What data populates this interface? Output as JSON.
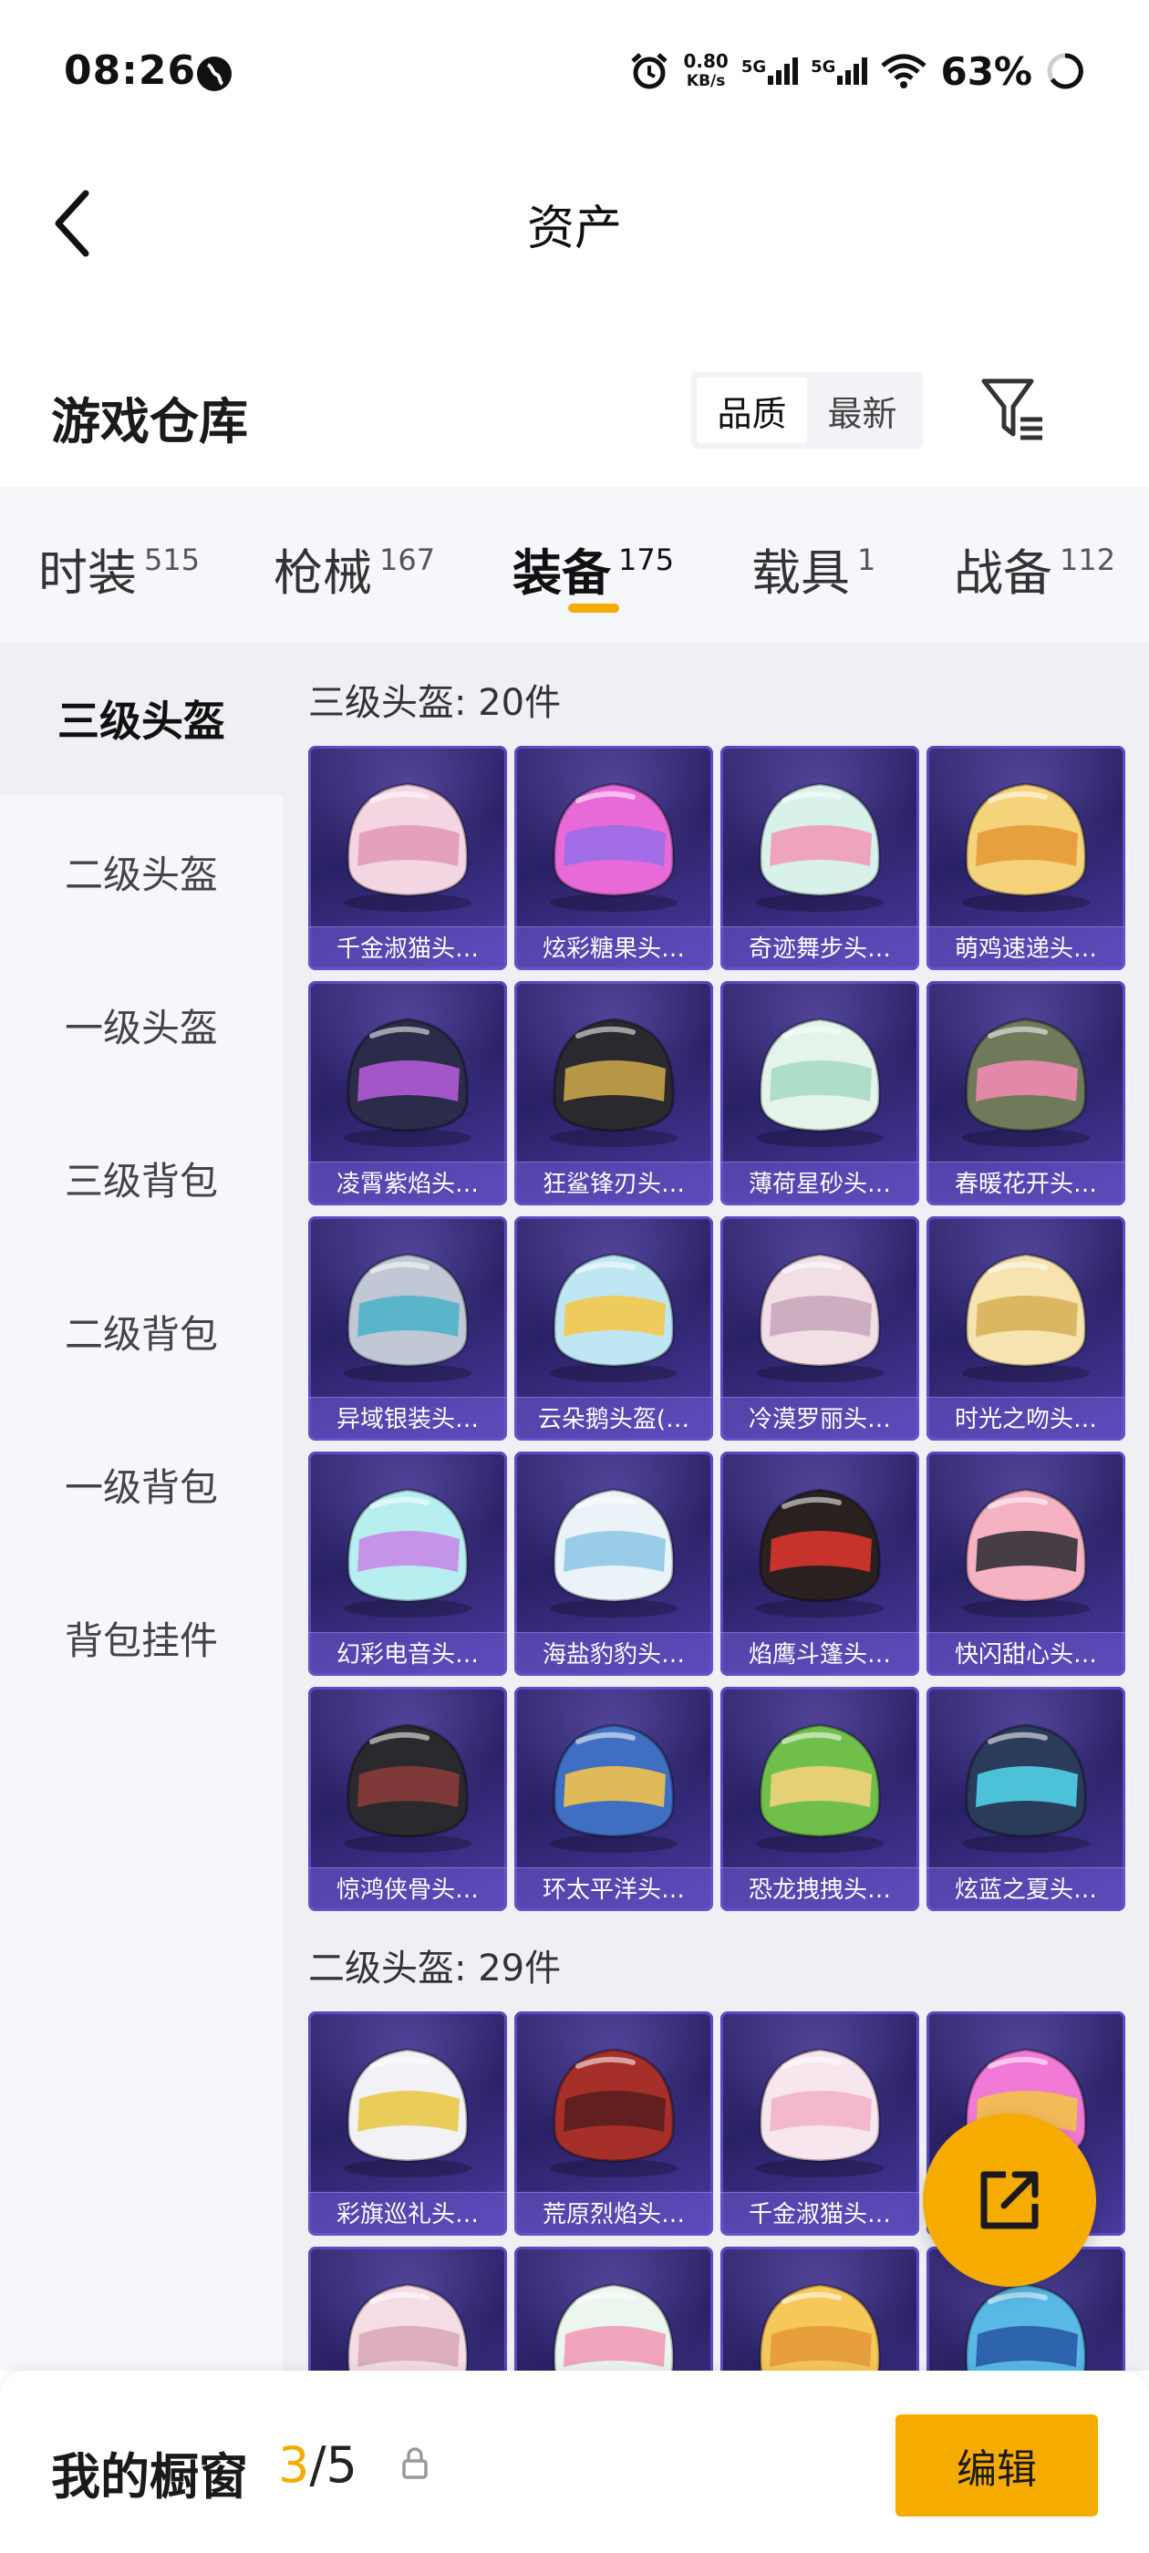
{
  "status_bar": {
    "time": "08:26",
    "net_speed_value": "0.80",
    "net_speed_unit": "KB/s",
    "sim1": "5G",
    "sim2": "5G",
    "battery": "63%"
  },
  "header": {
    "title": "资产"
  },
  "warehouse": {
    "title": "游戏仓库",
    "sort_options": [
      {
        "label": "品质",
        "active": true
      },
      {
        "label": "最新",
        "active": false
      }
    ]
  },
  "tabs": [
    {
      "label": "时装",
      "count": "515"
    },
    {
      "label": "枪械",
      "count": "167"
    },
    {
      "label": "装备",
      "count": "175",
      "active": true
    },
    {
      "label": "载具",
      "count": "1"
    },
    {
      "label": "战备",
      "count": "112"
    }
  ],
  "sidebar": {
    "items": [
      {
        "label": "三级头盔",
        "active": true
      },
      {
        "label": "二级头盔"
      },
      {
        "label": "一级头盔"
      },
      {
        "label": "三级背包"
      },
      {
        "label": "二级背包"
      },
      {
        "label": "一级背包"
      },
      {
        "label": "背包挂件"
      }
    ]
  },
  "sections": [
    {
      "title": "三级头盔: 20件",
      "items": [
        {
          "name": "千金淑猫头…",
          "colors": [
            "#f4d6e2",
            "#e39ab8"
          ]
        },
        {
          "name": "炫彩糖果头…",
          "colors": [
            "#e86ad8",
            "#9a6ee8"
          ]
        },
        {
          "name": "奇迹舞步头…",
          "colors": [
            "#d8f1ea",
            "#f29bb8"
          ]
        },
        {
          "name": "萌鸡速递头…",
          "colors": [
            "#f5d37a",
            "#e59a3a"
          ]
        },
        {
          "name": "凌霄紫焰头…",
          "colors": [
            "#2b2b4a",
            "#b05bd6"
          ]
        },
        {
          "name": "狂鲨锋刃头…",
          "colors": [
            "#2a2a2e",
            "#c8a24a"
          ]
        },
        {
          "name": "薄荷星砂头…",
          "colors": [
            "#e4f4ea",
            "#a9dcc4"
          ]
        },
        {
          "name": "春暖花开头…",
          "colors": [
            "#6e7a5a",
            "#f08ab0"
          ]
        },
        {
          "name": "异域银装头…",
          "colors": [
            "#bfc8d4",
            "#4fb3c9"
          ]
        },
        {
          "name": "云朵鹅头盔(…",
          "colors": [
            "#bfe7f3",
            "#f2c94c"
          ]
        },
        {
          "name": "冷漠罗丽头…",
          "colors": [
            "#f2dfe6",
            "#c9a8bc"
          ]
        },
        {
          "name": "时光之吻头…",
          "colors": [
            "#f6e3b0",
            "#d9b15a"
          ]
        },
        {
          "name": "幻彩电音头…",
          "colors": [
            "#b7eef0",
            "#c58ae8"
          ]
        },
        {
          "name": "海盐豹豹头…",
          "colors": [
            "#eaf4f8",
            "#8fc8e6"
          ]
        },
        {
          "name": "焰鹰斗篷头…",
          "colors": [
            "#2a2020",
            "#d8342c"
          ]
        },
        {
          "name": "快闪甜心头…",
          "colors": [
            "#f4b2c2",
            "#333038"
          ]
        },
        {
          "name": "惊鸿侠骨头…",
          "colors": [
            "#2a2a2e",
            "#8a3b3b"
          ]
        },
        {
          "name": "环太平洋头…",
          "colors": [
            "#3e6fc2",
            "#f2c14e"
          ]
        },
        {
          "name": "恐龙拽拽头…",
          "colors": [
            "#6fbf4a",
            "#f2d27a"
          ]
        },
        {
          "name": "炫蓝之夏头…",
          "colors": [
            "#2b3b5a",
            "#4fd1e6"
          ]
        }
      ]
    },
    {
      "title": "二级头盔: 29件",
      "items": [
        {
          "name": "彩旗巡礼头…",
          "colors": [
            "#f2f2f6",
            "#e9c84a"
          ]
        },
        {
          "name": "荒原烈焰头…",
          "colors": [
            "#a62f2a",
            "#5a1e1e"
          ]
        },
        {
          "name": "千金淑猫头…",
          "colors": [
            "#f7e6ee",
            "#f2b2c8"
          ]
        },
        {
          "name": "",
          "colors": [
            "#f07ad6",
            "#f2c24a"
          ]
        },
        {
          "name": "",
          "colors": [
            "#f4dde4",
            "#d9a9b9"
          ]
        },
        {
          "name": "",
          "colors": [
            "#eaf6ee",
            "#f29bb8"
          ]
        },
        {
          "name": "",
          "colors": [
            "#f6c85a",
            "#e59a3a"
          ]
        },
        {
          "name": "",
          "colors": [
            "#58b8e6",
            "#2a5aa6"
          ]
        }
      ]
    }
  ],
  "fab": {
    "icon": "share-external-icon"
  },
  "bottom_bar": {
    "label": "我的橱窗",
    "current": "3",
    "separator_total": "/5",
    "edit_label": "编辑"
  },
  "colors": {
    "accent": "#f6ab00",
    "card_bg": "#2a2266",
    "card_border": "#5a49c2"
  }
}
